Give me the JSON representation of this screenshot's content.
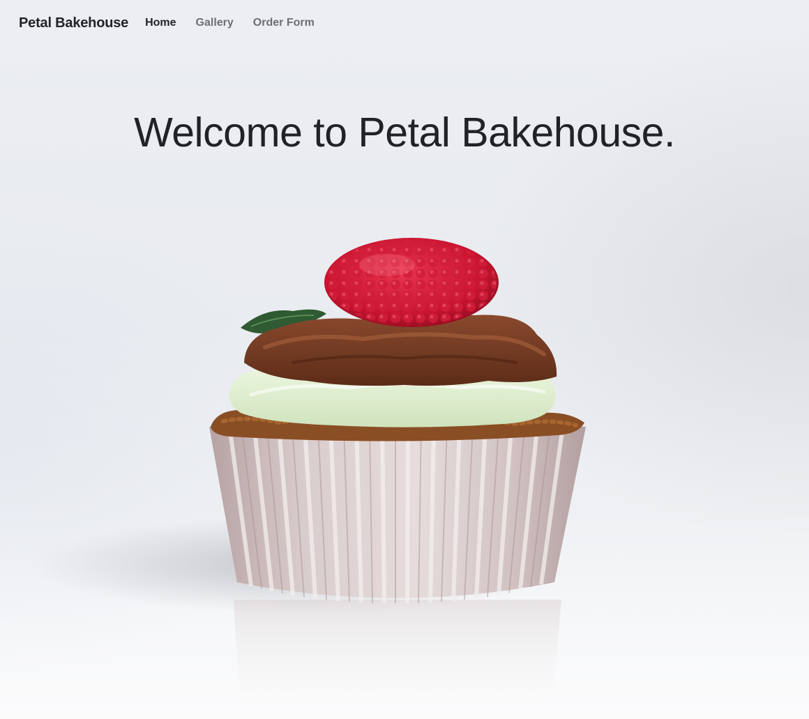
{
  "navbar": {
    "brand": "Petal Bakehouse",
    "links": [
      {
        "label": "Home",
        "active": true
      },
      {
        "label": "Gallery",
        "active": false
      },
      {
        "label": "Order Form",
        "active": false
      }
    ]
  },
  "hero": {
    "title": "Welcome to Petal Bakehouse."
  },
  "image": {
    "subject": "cupcake-image"
  },
  "colors": {
    "text_dark": "#1f2327",
    "text_muted": "#6c7075",
    "background": "#eceef1"
  }
}
